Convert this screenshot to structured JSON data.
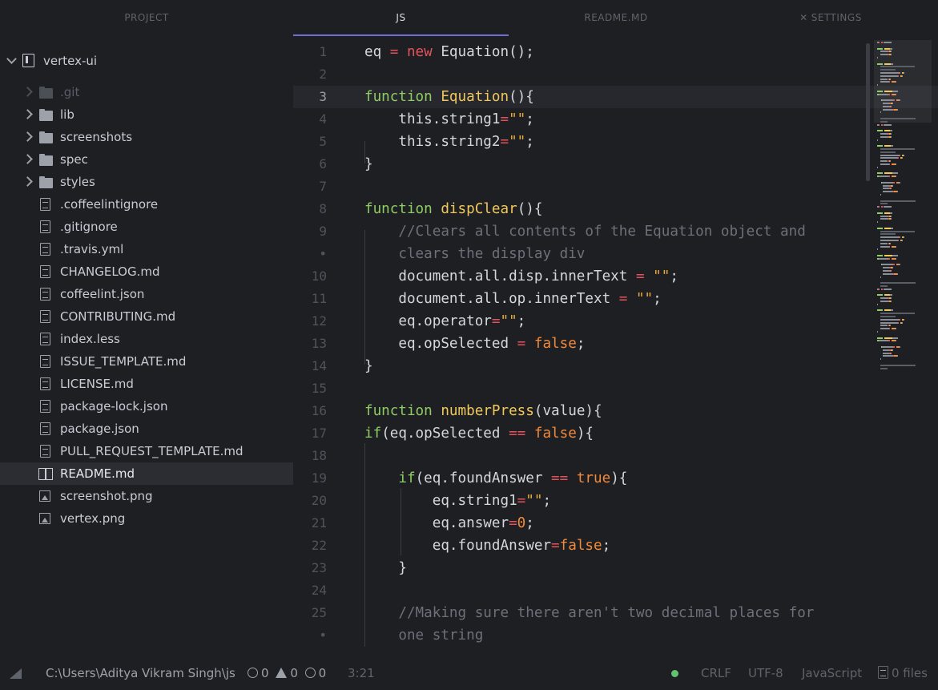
{
  "tabs": [
    {
      "label": "PROJECT",
      "active": false
    },
    {
      "label": "JS",
      "active": true
    },
    {
      "label": "README.MD",
      "active": false
    },
    {
      "label": "SETTINGS",
      "active": false,
      "icon": "tools-icon"
    }
  ],
  "tree": {
    "root": "vertex-ui",
    "items": [
      {
        "label": ".git",
        "type": "folder",
        "dim": true
      },
      {
        "label": "lib",
        "type": "folder"
      },
      {
        "label": "screenshots",
        "type": "folder"
      },
      {
        "label": "spec",
        "type": "folder"
      },
      {
        "label": "styles",
        "type": "folder"
      },
      {
        "label": ".coffeelintignore",
        "type": "file"
      },
      {
        "label": ".gitignore",
        "type": "file"
      },
      {
        "label": ".travis.yml",
        "type": "file"
      },
      {
        "label": "CHANGELOG.md",
        "type": "file"
      },
      {
        "label": "coffeelint.json",
        "type": "file"
      },
      {
        "label": "CONTRIBUTING.md",
        "type": "file"
      },
      {
        "label": "index.less",
        "type": "file"
      },
      {
        "label": "ISSUE_TEMPLATE.md",
        "type": "file"
      },
      {
        "label": "LICENSE.md",
        "type": "file"
      },
      {
        "label": "package-lock.json",
        "type": "file"
      },
      {
        "label": "package.json",
        "type": "file"
      },
      {
        "label": "PULL_REQUEST_TEMPLATE.md",
        "type": "file"
      },
      {
        "label": "README.md",
        "type": "book",
        "selected": true
      },
      {
        "label": "screenshot.png",
        "type": "image"
      },
      {
        "label": "vertex.png",
        "type": "image"
      }
    ]
  },
  "editor": {
    "current_line": "3",
    "lines": [
      {
        "n": "1",
        "tokens": [
          [
            "",
            "eq "
          ],
          [
            "o",
            "="
          ],
          [
            "",
            " "
          ],
          [
            "kr",
            "new"
          ],
          [
            "",
            " Equation();"
          ]
        ]
      },
      {
        "n": "2",
        "tokens": []
      },
      {
        "n": "3",
        "tokens": [
          [
            "k",
            "function"
          ],
          [
            "",
            " "
          ],
          [
            "f",
            "Equation"
          ],
          [
            "",
            "(){"
          ]
        ]
      },
      {
        "n": "4",
        "tokens": [
          [
            "",
            "    this.string1"
          ],
          [
            "o",
            "="
          ],
          [
            "s",
            "\"\""
          ],
          [
            "",
            ";"
          ]
        ]
      },
      {
        "n": "5",
        "tokens": [
          [
            "",
            "    this.string2"
          ],
          [
            "o",
            "="
          ],
          [
            "s",
            "\"\""
          ],
          [
            "",
            ";"
          ]
        ]
      },
      {
        "n": "6",
        "tokens": [
          [
            "",
            "}"
          ]
        ]
      },
      {
        "n": "7",
        "tokens": []
      },
      {
        "n": "8",
        "tokens": [
          [
            "k",
            "function"
          ],
          [
            "",
            " "
          ],
          [
            "f",
            "dispClear"
          ],
          [
            "",
            "(){"
          ]
        ]
      },
      {
        "n": "9",
        "tokens": [
          [
            "c",
            "    //Clears all contents of the Equation object and"
          ]
        ]
      },
      {
        "n": "•",
        "tokens": [
          [
            "c",
            "    clears the display div"
          ]
        ]
      },
      {
        "n": "10",
        "tokens": [
          [
            "",
            "    document.all.disp.innerText "
          ],
          [
            "o",
            "="
          ],
          [
            "",
            " "
          ],
          [
            "s",
            "\"\""
          ],
          [
            "",
            ";"
          ]
        ]
      },
      {
        "n": "11",
        "tokens": [
          [
            "",
            "    document.all.op.innerText "
          ],
          [
            "o",
            "="
          ],
          [
            "",
            " "
          ],
          [
            "s",
            "\"\""
          ],
          [
            "",
            ";"
          ]
        ]
      },
      {
        "n": "12",
        "tokens": [
          [
            "",
            "    eq.operator"
          ],
          [
            "o",
            "="
          ],
          [
            "s",
            "\"\""
          ],
          [
            "",
            ";"
          ]
        ]
      },
      {
        "n": "13",
        "tokens": [
          [
            "",
            "    eq.opSelected "
          ],
          [
            "o",
            "="
          ],
          [
            "",
            " "
          ],
          [
            "b",
            "false"
          ],
          [
            "",
            ";"
          ]
        ]
      },
      {
        "n": "14",
        "tokens": [
          [
            "",
            "}"
          ]
        ]
      },
      {
        "n": "15",
        "tokens": []
      },
      {
        "n": "16",
        "tokens": [
          [
            "k",
            "function"
          ],
          [
            "",
            " "
          ],
          [
            "f",
            "numberPress"
          ],
          [
            "",
            "(value){"
          ]
        ]
      },
      {
        "n": "17",
        "tokens": [
          [
            "k",
            "if"
          ],
          [
            "",
            "(eq.opSelected "
          ],
          [
            "o",
            "=="
          ],
          [
            "",
            " "
          ],
          [
            "b",
            "false"
          ],
          [
            "",
            "){"
          ]
        ]
      },
      {
        "n": "18",
        "tokens": []
      },
      {
        "n": "19",
        "tokens": [
          [
            "",
            "    "
          ],
          [
            "k",
            "if"
          ],
          [
            "",
            "(eq.foundAnswer "
          ],
          [
            "o",
            "=="
          ],
          [
            "",
            " "
          ],
          [
            "b",
            "true"
          ],
          [
            "",
            "){"
          ]
        ]
      },
      {
        "n": "20",
        "tokens": [
          [
            "",
            "        eq.string1"
          ],
          [
            "o",
            "="
          ],
          [
            "s",
            "\"\""
          ],
          [
            "",
            ";"
          ]
        ]
      },
      {
        "n": "21",
        "tokens": [
          [
            "",
            "        eq.answer"
          ],
          [
            "o",
            "="
          ],
          [
            "b",
            "0"
          ],
          [
            "",
            ";"
          ]
        ]
      },
      {
        "n": "22",
        "tokens": [
          [
            "",
            "        eq.foundAnswer"
          ],
          [
            "o",
            "="
          ],
          [
            "b",
            "false"
          ],
          [
            "",
            ";"
          ]
        ]
      },
      {
        "n": "23",
        "tokens": [
          [
            "",
            "    }"
          ]
        ]
      },
      {
        "n": "24",
        "tokens": []
      },
      {
        "n": "25",
        "tokens": [
          [
            "c",
            "    //Making sure there aren't two decimal places for"
          ]
        ]
      },
      {
        "n": "•",
        "tokens": [
          [
            "c",
            "    one string"
          ]
        ]
      }
    ]
  },
  "status": {
    "path": "C:\\Users\\Aditya Vikram Singh\\js",
    "errors": "0",
    "warnings": "0",
    "infos": "0",
    "cursor": "3:21",
    "line_ending": "CRLF",
    "encoding": "UTF-8",
    "grammar": "JavaScript",
    "files": "0 files"
  },
  "colors": {
    "background": "#1e1f23",
    "accent": "#6c6fd4",
    "keyword": "#8fcc63",
    "function": "#f1c85c",
    "string": "#e9ab3a",
    "boolean": "#f28a3c",
    "operator": "#e4535c",
    "comment": "#6b7079"
  }
}
